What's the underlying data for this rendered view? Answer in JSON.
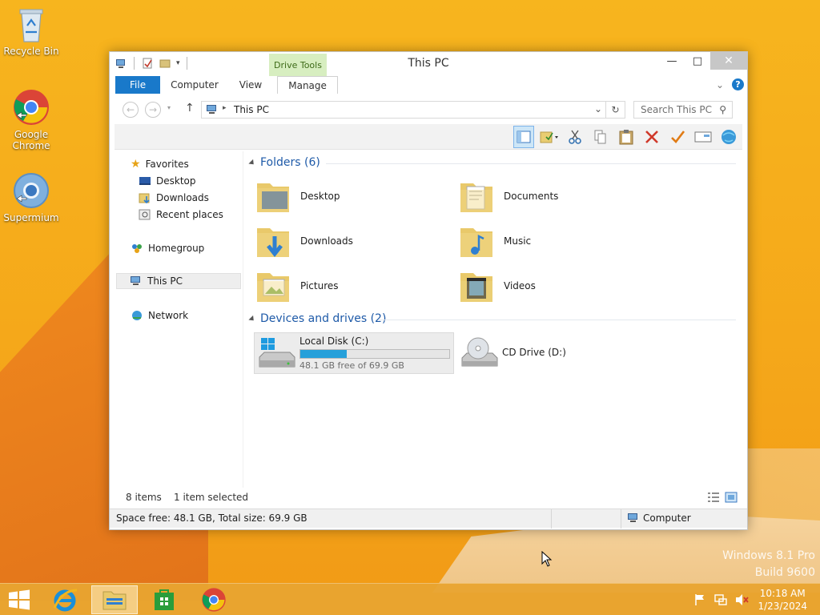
{
  "desktop": {
    "icons": [
      {
        "label": "Recycle Bin"
      },
      {
        "label": "Google Chrome"
      },
      {
        "label": "Supermium"
      }
    ],
    "watermark": {
      "line1": "Windows 8.1 Pro",
      "line2": "Build 9600"
    }
  },
  "window": {
    "title": "This PC",
    "contextual_tab": "Drive Tools",
    "ribbon_tabs": [
      "File",
      "Computer",
      "View",
      "Manage"
    ],
    "address": "This PC",
    "search_placeholder": "Search This PC",
    "nav": {
      "favorites": "Favorites",
      "desktop": "Desktop",
      "downloads": "Downloads",
      "recent": "Recent places",
      "homegroup": "Homegroup",
      "thispc": "This PC",
      "network": "Network"
    },
    "folders_header": "Folders (6)",
    "folders": [
      "Desktop",
      "Documents",
      "Downloads",
      "Music",
      "Pictures",
      "Videos"
    ],
    "devices_header": "Devices and drives (2)",
    "drives": {
      "c": {
        "name": "Local Disk (C:)",
        "free_text": "48.1 GB free of 69.9 GB",
        "used_fraction": 0.31
      },
      "d": {
        "name": "CD Drive (D:)"
      }
    },
    "status": {
      "items": "8 items",
      "selected": "1 item selected",
      "space": "Space free: 48.1 GB, Total size: 69.9 GB",
      "location": "Computer"
    }
  },
  "taskbar": {
    "time": "10:18 AM",
    "date": "1/23/2024"
  },
  "colors": {
    "accent": "#1979ca",
    "drive_bar": "#26a0da",
    "drive_tools": "#d7eec0",
    "header_blue": "#1e5aa8"
  }
}
